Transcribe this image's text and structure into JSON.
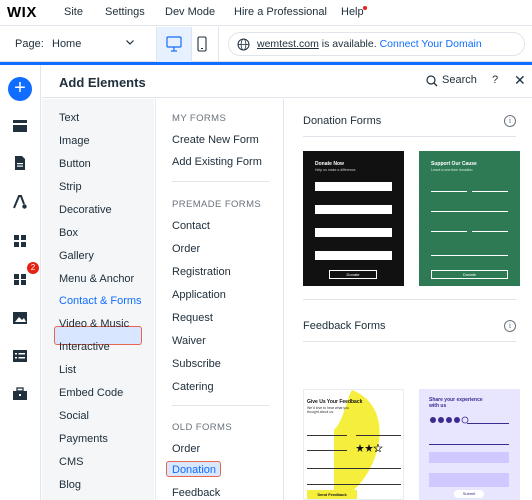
{
  "topbar": {
    "logo": "WIX",
    "nav": [
      "Site",
      "Settings",
      "Dev Mode",
      "Hire a Professional",
      "Help"
    ]
  },
  "pagebar": {
    "page_label": "Page:",
    "page_value": "Home",
    "url_domain": "wemtest.com",
    "url_available": "is available.",
    "url_link": "Connect Your Domain"
  },
  "rail": {
    "badge_count": "2",
    "icons": [
      "add-icon",
      "sections-icon",
      "pages-icon",
      "design-icon",
      "apps-icon",
      "app-market-icon",
      "media-icon",
      "cms-icon",
      "business-icon"
    ]
  },
  "panel": {
    "title": "Add Elements",
    "search_label": "Search",
    "help_label": "?",
    "close_label": "✕"
  },
  "categories": [
    "Text",
    "Image",
    "Button",
    "Strip",
    "Decorative",
    "Box",
    "Gallery",
    "Menu & Anchor",
    "Contact & Forms",
    "Video & Music",
    "Interactive",
    "List",
    "Embed Code",
    "Social",
    "Payments",
    "CMS",
    "Blog"
  ],
  "selected_category": "Contact & Forms",
  "subcategories": {
    "my_forms_heading": "MY FORMS",
    "my_forms": [
      "Create New Form",
      "Add Existing Form"
    ],
    "premade_heading": "PREMADE FORMS",
    "premade": [
      "Contact",
      "Order",
      "Registration",
      "Application",
      "Request",
      "Waiver",
      "Subscribe",
      "Catering"
    ],
    "old_heading": "OLD FORMS",
    "old": [
      "Order",
      "Donation",
      "Feedback"
    ],
    "selected": "Donation"
  },
  "preview": {
    "donation_title": "Donation Forms",
    "feedback_title": "Feedback Forms",
    "info_label": "i",
    "donate_now_title": "Donate Now",
    "donate_now_sub": "Help us make a difference",
    "donate_now_button": "Donate",
    "support_title": "Support Our Cause",
    "support_sub": "Leave a one-time donation",
    "support_button": "Donate",
    "feedback1_title": "Give Us Your Feedback",
    "feedback1_sub": "We'd love to hear what you thought about us.",
    "feedback1_button": "Send Feedback",
    "feedback2_title": "Share your experience with us",
    "feedback2_button": "Submit"
  },
  "colors": {
    "accent": "#116dff",
    "selection_outline": "#e8654f",
    "selection_fill": "#d8e6ff",
    "badge": "#e62214"
  }
}
